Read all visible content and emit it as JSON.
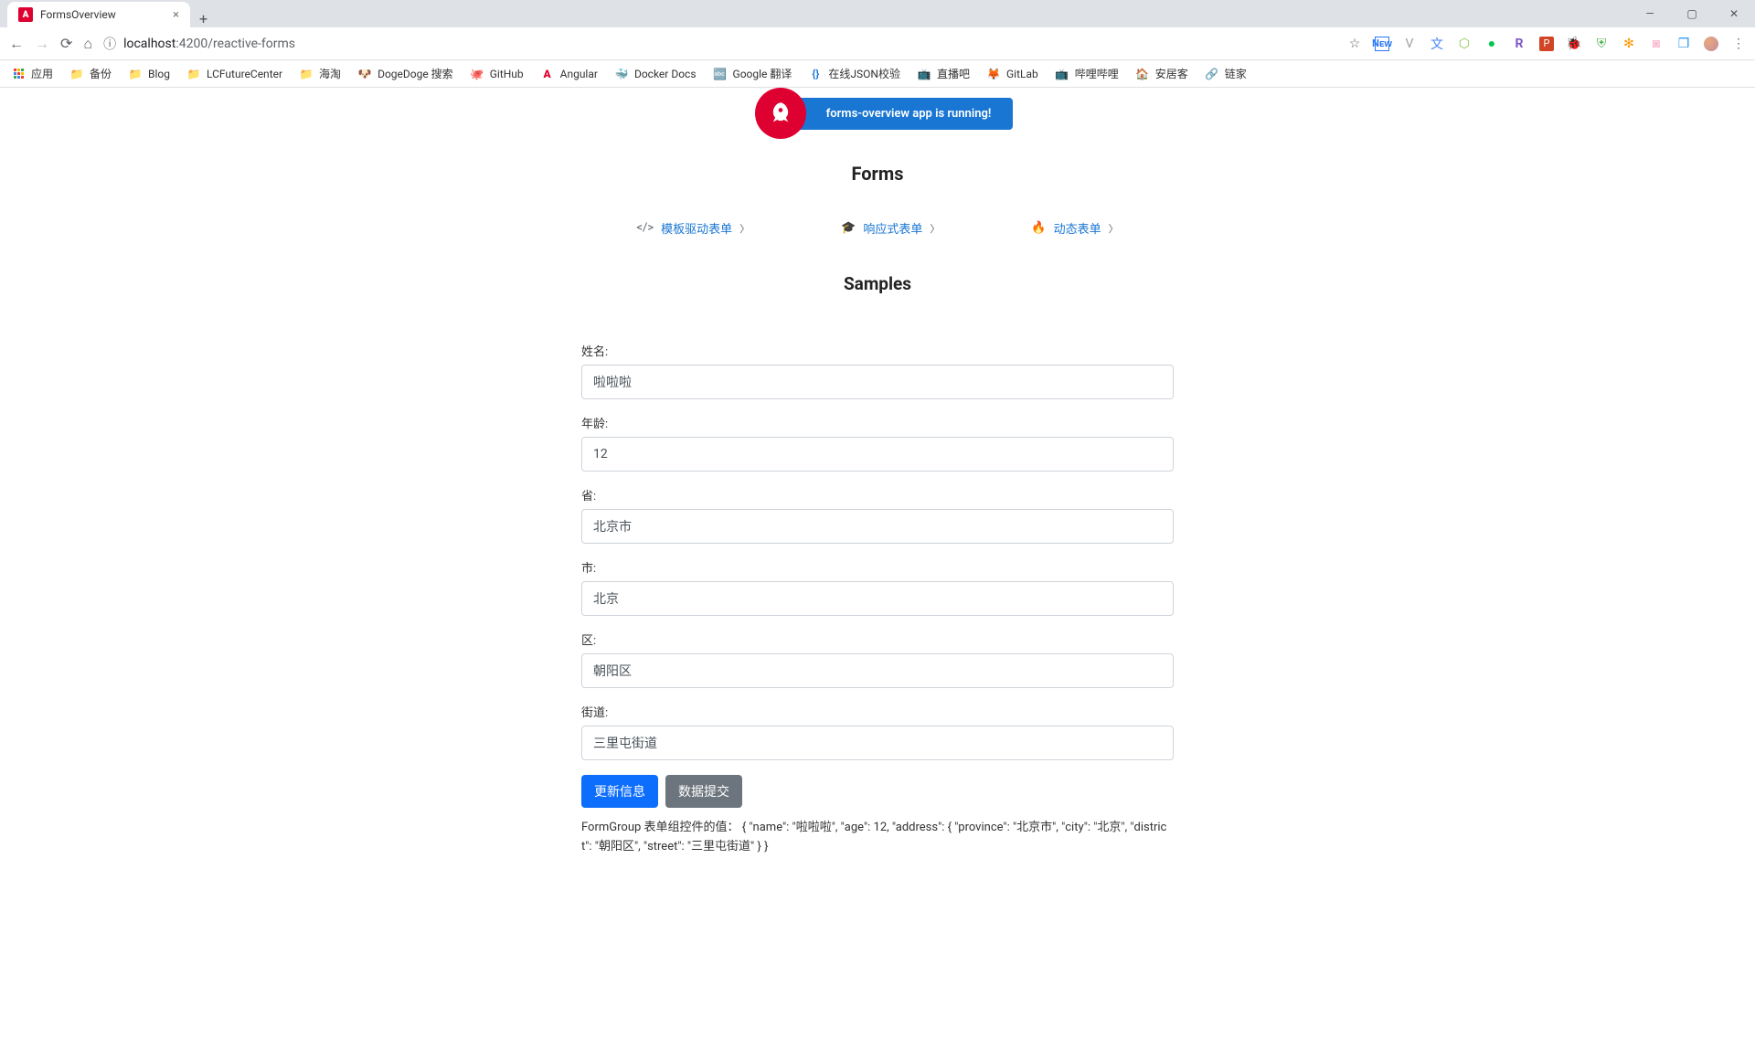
{
  "window": {
    "tab_title": "FormsOverview",
    "url_host": "localhost",
    "url_port": ":4200",
    "url_path": "/reactive-forms"
  },
  "bookmarks": [
    {
      "icon": "apps",
      "label": "应用"
    },
    {
      "icon": "folder",
      "label": "备份"
    },
    {
      "icon": "folder",
      "label": "Blog"
    },
    {
      "icon": "folder",
      "label": "LCFutureCenter"
    },
    {
      "icon": "folder",
      "label": "海淘"
    },
    {
      "icon": "doge",
      "label": "DogeDoge 搜索"
    },
    {
      "icon": "github",
      "label": "GitHub"
    },
    {
      "icon": "angular",
      "label": "Angular"
    },
    {
      "icon": "docker",
      "label": "Docker Docs"
    },
    {
      "icon": "translate",
      "label": "Google 翻译"
    },
    {
      "icon": "json",
      "label": "在线JSON校验"
    },
    {
      "icon": "huya",
      "label": "直播吧"
    },
    {
      "icon": "gitlab",
      "label": "GitLab"
    },
    {
      "icon": "bili",
      "label": "哔哩哔哩"
    },
    {
      "icon": "anjuke",
      "label": "安居客"
    },
    {
      "icon": "lianjia",
      "label": "链家"
    }
  ],
  "hero": {
    "running_text": "forms-overview app is running!"
  },
  "headings": {
    "forms": "Forms",
    "samples": "Samples"
  },
  "nav_links": [
    {
      "icon": "code",
      "label": "模板驱动表单"
    },
    {
      "icon": "school",
      "label": "响应式表单"
    },
    {
      "icon": "fire",
      "label": "动态表单"
    }
  ],
  "form": {
    "name": {
      "label": "姓名:",
      "value": "啦啦啦"
    },
    "age": {
      "label": "年龄:",
      "value": "12"
    },
    "province": {
      "label": "省:",
      "value": "北京市"
    },
    "city": {
      "label": "市:",
      "value": "北京"
    },
    "district": {
      "label": "区:",
      "value": "朝阳区"
    },
    "street": {
      "label": "街道:",
      "value": "三里屯街道"
    }
  },
  "buttons": {
    "update": "更新信息",
    "submit": "数据提交"
  },
  "dump": {
    "prefix": "FormGroup 表单组控件的值： ",
    "json": "{ \"name\": \"啦啦啦\", \"age\": 12, \"address\": { \"province\": \"北京市\", \"city\": \"北京\", \"district\": \"朝阳区\", \"street\": \"三里屯街道\" } }"
  }
}
